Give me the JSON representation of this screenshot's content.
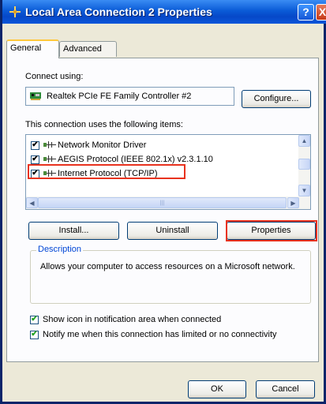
{
  "window": {
    "title": "Local Area Connection 2 Properties",
    "help_glyph": "?",
    "close_glyph": "X"
  },
  "tabs": [
    {
      "label": "General",
      "active": true
    },
    {
      "label": "Advanced",
      "active": false
    }
  ],
  "general": {
    "connect_using_label": "Connect using:",
    "adapter_name": "Realtek PCIe FE Family Controller #2",
    "configure_label": "Configure...",
    "items_label": "This connection uses the following items:",
    "items": [
      {
        "label": "Network Monitor Driver",
        "checked": true
      },
      {
        "label": "AEGIS Protocol (IEEE 802.1x) v2.3.1.10",
        "checked": true
      },
      {
        "label": "Internet Protocol (TCP/IP)",
        "checked": true,
        "highlighted": true
      }
    ],
    "install_label": "Install...",
    "uninstall_label": "Uninstall",
    "properties_label": "Properties",
    "description_title": "Description",
    "description_text": "Allows your computer to access resources on a Microsoft network.",
    "show_icon_label": "Show icon in notification area when connected",
    "notify_label": "Notify me when this connection has limited or no connectivity",
    "show_icon_checked": true,
    "notify_checked": true
  },
  "footer": {
    "ok_label": "OK",
    "cancel_label": "Cancel"
  },
  "colors": {
    "title_bar": "#0A5BD7",
    "highlight_box": "#E8321E",
    "description_title": "#0046D5",
    "check_mark": "#21A121"
  },
  "icons": {
    "title": "network-connection-icon",
    "adapter": "network-card-icon",
    "item": "network-component-icon"
  }
}
